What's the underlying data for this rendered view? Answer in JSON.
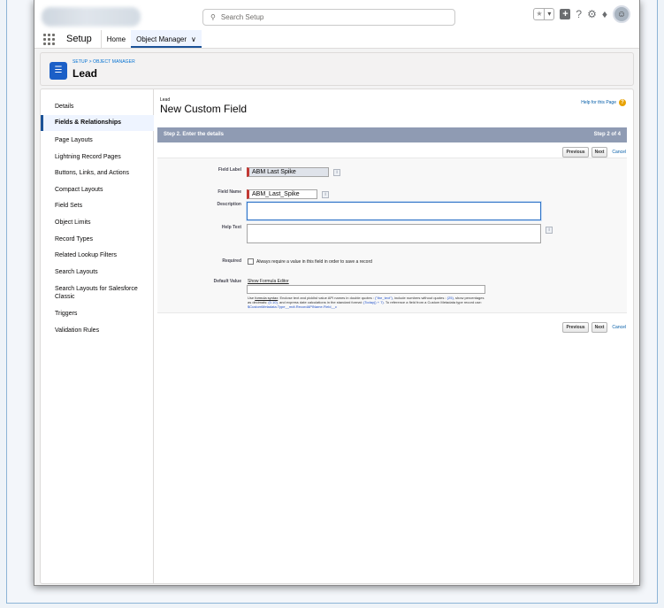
{
  "header": {
    "search_placeholder": "Search Setup",
    "avatar_glyph": "☺"
  },
  "nav": {
    "app_name": "Setup",
    "items": [
      "Home",
      "Object Manager"
    ]
  },
  "object_header": {
    "breadcrumb": "SETUP > OBJECT MANAGER",
    "title": "Lead"
  },
  "sidebar": {
    "items": [
      "Details",
      "Fields & Relationships",
      "Page Layouts",
      "Lightning Record Pages",
      "Buttons, Links, and Actions",
      "Compact Layouts",
      "Field Sets",
      "Object Limits",
      "Record Types",
      "Related Lookup Filters",
      "Search Layouts",
      "Search Layouts for Salesforce Classic",
      "Triggers",
      "Validation Rules"
    ],
    "active_index": 1
  },
  "main": {
    "object_label": "Lead",
    "title": "New Custom Field",
    "help_link": "Help for this Page",
    "step_title": "Step 2. Enter the details",
    "step_count": "Step 2 of 4",
    "buttons": {
      "previous": "Previous",
      "next": "Next",
      "cancel": "Cancel"
    },
    "fields": {
      "field_label": {
        "label": "Field Label",
        "value": "ABM Last Spike"
      },
      "field_name": {
        "label": "Field Name",
        "value": "ABM_Last_Spike"
      },
      "description": {
        "label": "Description",
        "value": ""
      },
      "help_text": {
        "label": "Help Text",
        "value": ""
      },
      "required": {
        "label": "Required",
        "checkbox_text": "Always require a value in this field in order to save a record",
        "checked": false
      },
      "default_value": {
        "label": "Default Value",
        "formula_link": "Show Formula Editor",
        "hint_parts": [
          "Use ",
          "formula syntax",
          ": Enclose text and picklist value API names in double quotes : ",
          "(\"the_text\")",
          ", include numbers without quotes : ",
          "(25)",
          ", show percentages as decimals: ",
          "(0.10)",
          ", and express date calculations in the standard format: ",
          "(Today() + 7)",
          ". To reference a field from a Custom Metadata type record use: ",
          "$CustomMetadata.Type__mdt.RecordAPIName.Field__c"
        ]
      }
    }
  }
}
